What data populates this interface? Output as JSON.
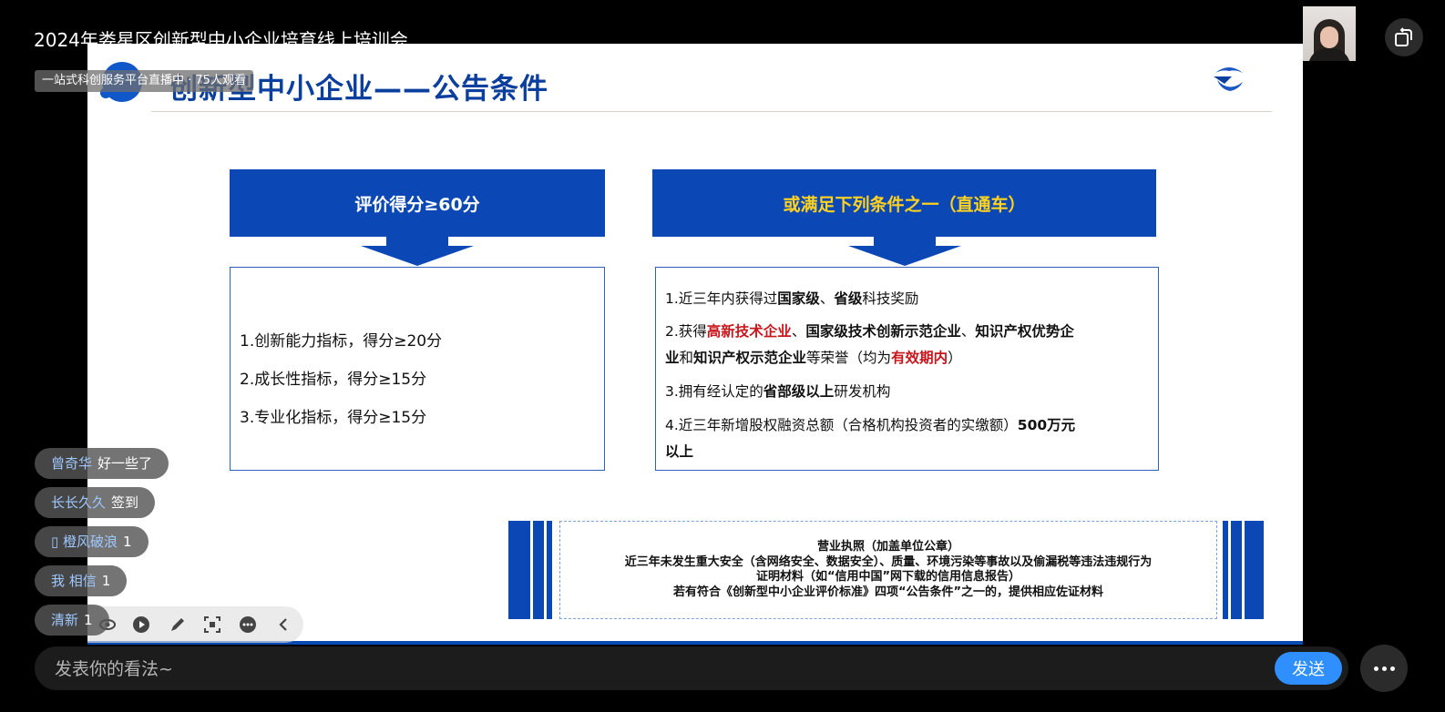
{
  "stream": {
    "title": "2024年娄星区创新型中小企业培育线上培训会",
    "badge": "一站式科创服务平台直播中 · 75人观看"
  },
  "slide": {
    "title": "创新型中小企业——公告条件",
    "left_header": "评价得分≥60分",
    "right_header": "或满足下列条件之一（直通车）",
    "left_items": [
      "1.创新能力指标，得分≥20分",
      "2.成长性指标，得分≥15分",
      "3.专业化指标，得分≥15分"
    ],
    "right_items": {
      "item1": {
        "a": "1.近三年内获得过",
        "b": "国家级",
        "c": "、",
        "d": "省级",
        "e": "科技奖励"
      },
      "item2": {
        "a": "2.获得",
        "b": "高新技术企业",
        "c": "、",
        "d": "国家级技术创新示范企业",
        "e": "、",
        "f": "知识产权优势企",
        "g": "业",
        "h": "和",
        "i": "知识产权示范企业",
        "j": "等荣誉（均为",
        "k": "有效期内",
        "l": "）"
      },
      "item3": {
        "a": "3.拥有经认定的",
        "b": "省部级以上",
        "c": "研发机构"
      },
      "item4": {
        "a": "4.近三年新增股权融资总额（合格机构投资者的实缴额）",
        "b": "500万元",
        "c": "以上"
      }
    },
    "bottom_lines": [
      "营业执照（加盖单位公章）",
      "近三年未发生重大安全（含网络安全、数据安全）、质量、环境污染等事故以及偷漏税等违法违规行为",
      "证明材料（如“信用中国”网下载的信用信息报告）",
      "若有符合《创新型中小企业评价标准》四项“公告条件”之一的，提供相应佐证材料"
    ]
  },
  "chat": [
    {
      "user": "曾奇华",
      "text": "好一些了"
    },
    {
      "user": "长长久久",
      "text": "签到"
    },
    {
      "user": "▯ 橙风破浪",
      "text": "1"
    },
    {
      "user": "我 相信",
      "text": "1"
    },
    {
      "user": "清新",
      "text": "1"
    }
  ],
  "input": {
    "placeholder": "发表你的看法~",
    "send_label": "发送"
  },
  "toolbar_icons": [
    "eye-icon",
    "play-icon",
    "pen-icon",
    "screenshot-icon",
    "more-dots-icon",
    "collapse-chevron-icon"
  ],
  "colors": {
    "slide_blue": "#0c48b5",
    "header_yellow": "#ffd21f",
    "highlight_red": "#c8161d",
    "send_blue": "#2f8fff"
  }
}
